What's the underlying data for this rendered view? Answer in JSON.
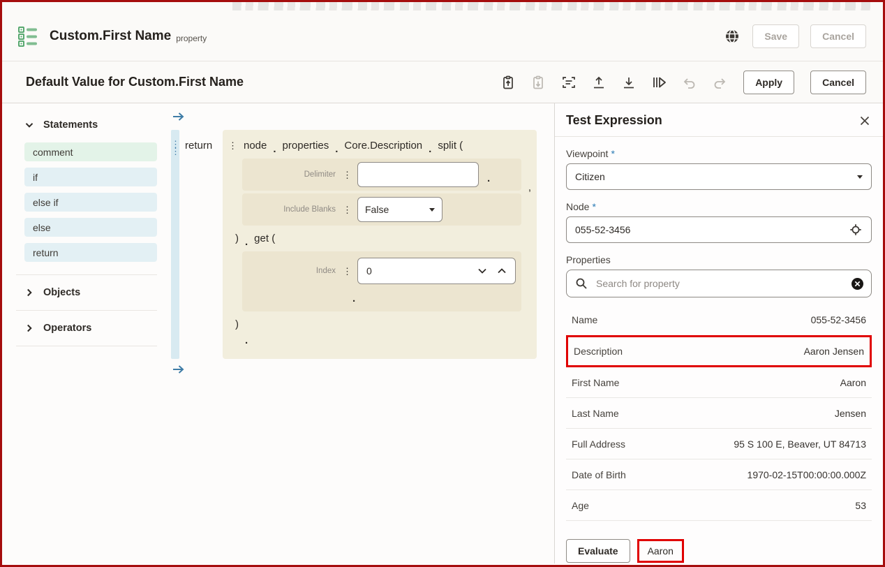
{
  "frame": {
    "border_color": "#a50d0d"
  },
  "annotation": {
    "highlight_color": "#e00000"
  },
  "app_header": {
    "icon": "property-list-icon",
    "title": "Custom.First Name",
    "type_label": "property",
    "actions_icon": "globe-icon",
    "save_label": "Save",
    "cancel_label": "Cancel",
    "save_enabled": false,
    "cancel_enabled": false
  },
  "expression_header": {
    "title": "Default Value for Custom.First Name",
    "toolbar_icons": [
      "clipboard-arrow-up-icon",
      "clipboard-arrow-down-icon",
      "expression-text-icon",
      "upload-icon",
      "download-icon",
      "run-expression-icon",
      "undo-icon",
      "redo-icon"
    ],
    "disabled_icons": [
      "clipboard-arrow-down-icon",
      "undo-icon",
      "redo-icon"
    ],
    "apply_label": "Apply",
    "cancel_label": "Cancel"
  },
  "sidebar": {
    "sections": [
      {
        "label": "Statements",
        "state": "expanded",
        "items": [
          "comment",
          "if",
          "else if",
          "else",
          "return"
        ]
      },
      {
        "label": "Objects",
        "state": "collapsed"
      },
      {
        "label": "Operators",
        "state": "collapsed"
      }
    ]
  },
  "editor": {
    "keyword": "return",
    "tokens": [
      "node",
      "properties",
      "Core.Description",
      "split ("
    ],
    "dot": ".",
    "comma": ",",
    "params": [
      {
        "label": "Delimiter",
        "value": "",
        "type": "text"
      },
      {
        "label": "Include Blanks",
        "value": "False",
        "type": "dropdown"
      },
      {
        "label": "Index",
        "value": "0",
        "type": "number-spinner"
      }
    ],
    "get_call": "get (",
    "close_paren": ")"
  },
  "test_panel": {
    "title": "Test Expression",
    "close_icon": "close-icon",
    "required_marker": "*",
    "viewpoint_label": "Viewpoint",
    "viewpoint_value": "Citizen",
    "node_label": "Node",
    "node_value": "055-52-3456",
    "node_icon": "locate-node-icon",
    "properties_label": "Properties",
    "search_icon": "search-icon",
    "search_placeholder": "Search for property",
    "clear_icon": "clear-search-icon",
    "properties": [
      {
        "name": "Name",
        "value": "055-52-3456",
        "highlighted": false
      },
      {
        "name": "Description",
        "value": "Aaron Jensen",
        "highlighted": true
      },
      {
        "name": "First Name",
        "value": "Aaron",
        "highlighted": false
      },
      {
        "name": "Last Name",
        "value": "Jensen",
        "highlighted": false
      },
      {
        "name": "Full Address",
        "value": "95 S 100 E, Beaver, UT 84713",
        "highlighted": false
      },
      {
        "name": "Date of Birth",
        "value": "1970-02-15T00:00:00.000Z",
        "highlighted": false
      },
      {
        "name": "Age",
        "value": "53",
        "highlighted": false
      }
    ],
    "evaluate_label": "Evaluate",
    "result_value": "Aaron",
    "result_highlighted": true
  }
}
